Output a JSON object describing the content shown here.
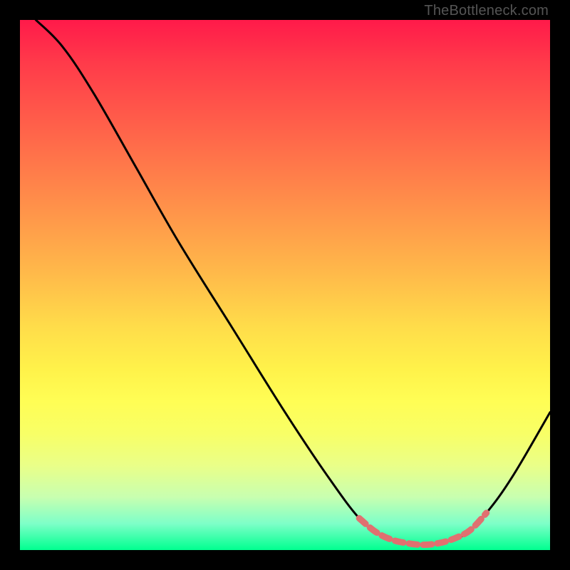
{
  "watermark": "TheBottleneck.com",
  "chart_data": {
    "type": "line",
    "title": "",
    "xlabel": "",
    "ylabel": "",
    "xlim": [
      0,
      100
    ],
    "ylim": [
      0,
      100
    ],
    "curve": [
      {
        "x": 3,
        "y": 100
      },
      {
        "x": 8,
        "y": 95
      },
      {
        "x": 14,
        "y": 86
      },
      {
        "x": 22,
        "y": 72
      },
      {
        "x": 30,
        "y": 58
      },
      {
        "x": 40,
        "y": 42
      },
      {
        "x": 50,
        "y": 26
      },
      {
        "x": 58,
        "y": 14
      },
      {
        "x": 64,
        "y": 6
      },
      {
        "x": 68,
        "y": 3
      },
      {
        "x": 72,
        "y": 1.5
      },
      {
        "x": 76,
        "y": 1
      },
      {
        "x": 80,
        "y": 1.5
      },
      {
        "x": 84,
        "y": 3
      },
      {
        "x": 88,
        "y": 7
      },
      {
        "x": 93,
        "y": 14
      },
      {
        "x": 100,
        "y": 26
      }
    ],
    "dashed_region": [
      {
        "x": 64,
        "y": 6
      },
      {
        "x": 67,
        "y": 3.5
      },
      {
        "x": 70,
        "y": 2
      },
      {
        "x": 73,
        "y": 1.3
      },
      {
        "x": 76,
        "y": 1
      },
      {
        "x": 79,
        "y": 1.3
      },
      {
        "x": 82,
        "y": 2.2
      },
      {
        "x": 85,
        "y": 3.8
      },
      {
        "x": 88,
        "y": 7
      }
    ]
  }
}
